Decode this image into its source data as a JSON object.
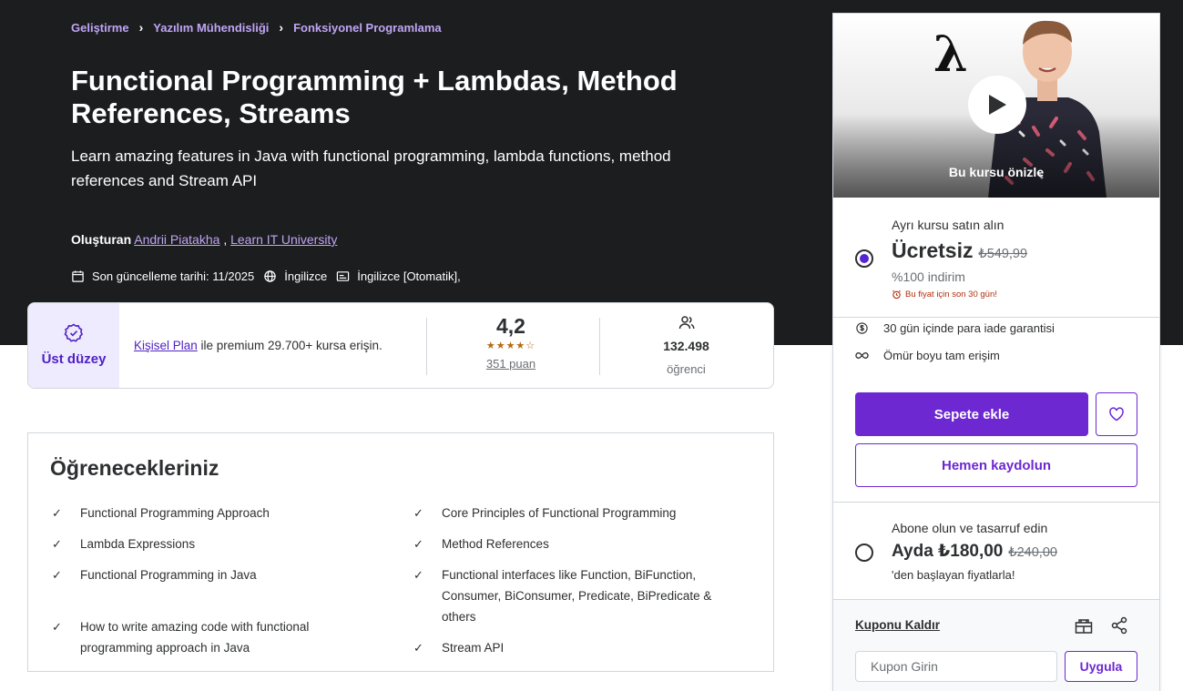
{
  "breadcrumb": [
    "Geliştirme",
    "Yazılım Mühendisliği",
    "Fonksiyonel Programlama"
  ],
  "course": {
    "title": "Functional Programming + Lambdas, Method References, Streams",
    "subtitle": "Learn amazing features in Java with functional programming, lambda functions, method references and Stream API",
    "created_by_label": "Oluşturan",
    "creators": [
      "Andrii Piatakha",
      "Learn IT University"
    ],
    "creator_sep": ",",
    "last_updated": "Son güncelleme tarihi: 11/2025",
    "language": "İngilizce",
    "captions": "İngilizce [Otomatik],"
  },
  "stats": {
    "badge": "Üst düzey",
    "plan_link": "Kişisel Plan",
    "plan_text": " ile premium 29.700+ kursa erişin.",
    "rating_value": "4,2",
    "rating_stars": 4.2,
    "rating_count": "351 puan",
    "students_count": "132.498",
    "students_label": "öğrenci"
  },
  "learn": {
    "heading": "Öğrenecekleriniz",
    "left": [
      "Functional Programming Approach",
      "Lambda Expressions",
      "Functional Programming in Java",
      "How to write amazing code with functional programming approach in Java"
    ],
    "right": [
      "Core Principles of Functional Programming",
      "Method References",
      "Functional interfaces like Function, BiFunction, Consumer, BiConsumer, Predicate, BiPredicate & others",
      "Stream API"
    ]
  },
  "sidebar": {
    "preview_caption": "Bu kursu önizle",
    "preview_symbol": "λ",
    "buy_label": "Ayrı kursu satın alın",
    "price": "Ücretsiz",
    "original_price": "₺549,99",
    "discount": "%100 indirim",
    "alarm": "Bu fiyat için son 30 gün!",
    "features": [
      "30 gün içinde para iade garantisi",
      "Ömür boyu tam erişim"
    ],
    "add_to_cart": "Sepete ekle",
    "enroll_now": "Hemen kaydolun",
    "subscribe_label": "Abone olun ve tasarruf edin",
    "sub_price": "Ayda ₺180,00",
    "sub_original": "₺240,00",
    "sub_note": "'den başlayan fiyatlarla!",
    "remove_coupon": "Kuponu Kaldır",
    "coupon_placeholder": "Kupon Girin",
    "apply": "Uygula"
  },
  "colors": {
    "hero_bg": "#1c1d1f",
    "accent": "#6d28d2",
    "link_purple": "#c0a5f4",
    "star": "#b4690e",
    "alarm_red": "#b32d0f"
  }
}
